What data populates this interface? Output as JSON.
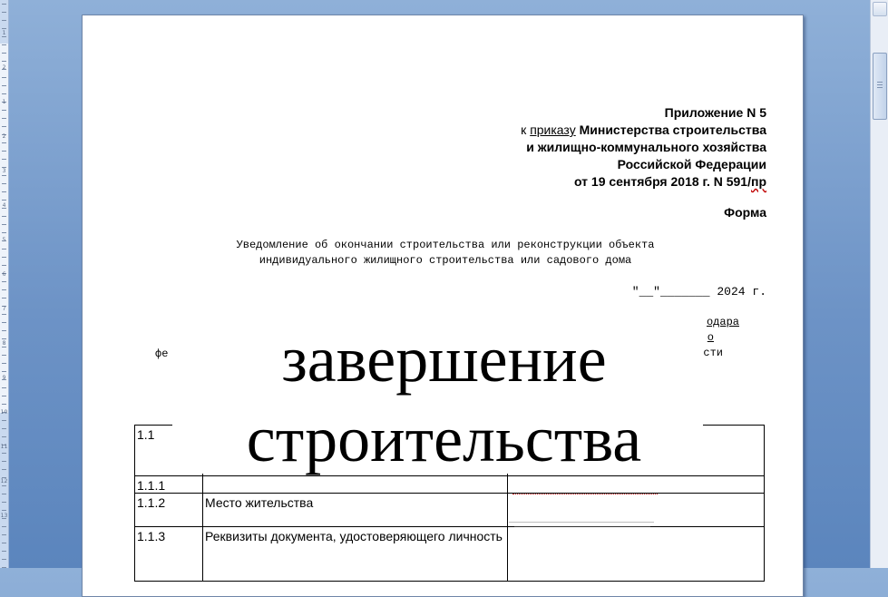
{
  "ruler": {
    "numbers": [
      "1",
      "2",
      "1",
      "2",
      "3",
      "4",
      "5",
      "6",
      "7",
      "8",
      "9",
      "10",
      "11",
      "12",
      "13"
    ]
  },
  "header": {
    "line1": "Приложение N 5",
    "line2_prefix": "к",
    "line2_link": "приказу",
    "line2_rest": "Министерства строительства",
    "line3": "и жилищно-коммунального хозяйства",
    "line4": "Российской Федерации",
    "line5_text": "от 19 сентября 2018 г. N 591/",
    "line5_squiggle": "пр"
  },
  "forma": "Форма",
  "notice": {
    "line1": "Уведомление об окончании строительства или реконструкции объекта",
    "line2": "индивидуального жилищного строительства или садового дома"
  },
  "date": "\"__\"_______ 2024 г.",
  "partial_text": {
    "right1": "одара",
    "right2": "о",
    "right3": "сти",
    "left1": "фе"
  },
  "table": {
    "rows": [
      {
        "num": "1.1",
        "label": "",
        "value": ""
      },
      {
        "num": "1.1.1",
        "label": "",
        "value": ""
      },
      {
        "num": "1.1.2",
        "label": "Место жительства",
        "value": ""
      },
      {
        "num": "1.1.3",
        "label": "Реквизиты документа, удостоверяющего личность",
        "value": ""
      }
    ]
  },
  "overlay": {
    "line1": "завершение",
    "line2": "строительства"
  }
}
